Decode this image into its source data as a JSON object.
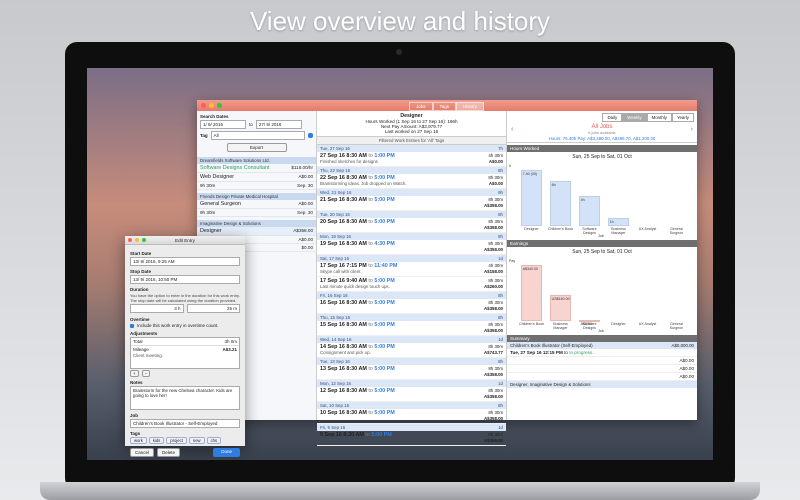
{
  "headline": "View overview and history",
  "window": {
    "tabs": [
      "Jobs",
      "Tags",
      "History"
    ],
    "active_tab": "History"
  },
  "left": {
    "search_dates_label": "Search Dates",
    "from_date": "1/ 9/ 2016",
    "to_label": "to",
    "to_date": "27/ 9/ 2016",
    "tag_label": "Tag",
    "tag_value": "All",
    "export_label": "Export",
    "groups": [
      {
        "head_left": "Dreamfields Software Solutions Ltd.",
        "head_right": "",
        "items": [
          {
            "title": "Software Designs Consultant",
            "right": "$116.00/hr",
            "sub_left": "",
            "sub_right": "Sep. 30",
            "title_class": "green"
          },
          {
            "title": "Web Designer",
            "right": "A$0.00",
            "sub_left": "9h 30m",
            "sub_right": "Sep. 30",
            "title_class": ""
          }
        ]
      },
      {
        "head_left": "Friends Design Private Medical Hospital",
        "head_right": "",
        "items": [
          {
            "title": "General Surgeon",
            "right": "A$0.00",
            "sub_left": "9h 30m",
            "sub_right": "Sep. 30",
            "title_class": ""
          }
        ]
      },
      {
        "head_left": "Imaginative Design & Solutions",
        "head_right": "",
        "items": [
          {
            "title": "Designer",
            "right": "A$358.00",
            "sub_left": "",
            "sub_right": "",
            "title_class": ""
          },
          {
            "title": "",
            "right": "A$0.00",
            "sub_left": "",
            "sub_right": "Oct. 30",
            "title_class": ""
          },
          {
            "title": "",
            "right": "$0.00",
            "sub_left": "",
            "sub_right": "Oct. 30",
            "title_class": ""
          }
        ]
      }
    ]
  },
  "mid": {
    "title": "Designer",
    "hours_line": "Hours Worked (1 Sep 16 to 27 Sep 16): 166h",
    "pay_line": "Next Pay Amount: A$3,979.77",
    "last_line": "Last worked on 27 Sep 16",
    "filter": "Filtered Work Entries for 'All' Tags",
    "days": [
      {
        "date": "Tue, 27 Sep 16",
        "total": "7h",
        "entries": [
          {
            "time": "27 Sep 16 8:30 AM",
            "to": "to",
            "end": "1:00 PM",
            "dur": "4h 30m",
            "note": "Finished sketches for designs",
            "amt": "A$0.00"
          }
        ]
      },
      {
        "date": "Thu, 22 Sep 16",
        "total": "8h",
        "entries": [
          {
            "time": "22 Sep 16 8:30 AM",
            "to": "to",
            "end": "5:00 PM",
            "dur": "8h 30m",
            "note": "Brainstorming ideas. Job dropped on Watch.",
            "amt": "A$0.00"
          }
        ]
      },
      {
        "date": "Wed, 21 Sep 16",
        "total": "9h",
        "entries": [
          {
            "time": "21 Sep 16 8:30 AM",
            "to": "to",
            "end": "5:00 PM",
            "dur": "8h 30m",
            "note": "",
            "amt": "A$358.00"
          }
        ]
      },
      {
        "date": "Tue, 20 Sep 16",
        "total": "8h",
        "entries": [
          {
            "time": "20 Sep 16 8:30 AM",
            "to": "to",
            "end": "5:00 PM",
            "dur": "8h 30m",
            "note": "",
            "amt": "A$358.00"
          }
        ]
      },
      {
        "date": "Mon, 19 Sep 16",
        "total": "8h",
        "entries": [
          {
            "time": "19 Sep 16 8:30 AM",
            "to": "to",
            "end": "4:30 PM",
            "dur": "8h 30m",
            "note": "",
            "amt": "A$358.00"
          }
        ]
      },
      {
        "date": "Sat, 17 Sep 16",
        "total": "1d",
        "entries": [
          {
            "time": "17 Sep 16 7:15 PM",
            "to": "to",
            "end": "11:40 PM",
            "dur": "4h 30m",
            "note": "Skype call with client",
            "amt": "A$158.00"
          },
          {
            "time": "17 Sep 16 9:40 AM",
            "to": "to",
            "end": "5:00 PM",
            "dur": "8h 30m",
            "note": "Last minute quick design touch ups.",
            "amt": "A$260.00"
          }
        ]
      },
      {
        "date": "Fri, 16 Sep 16",
        "total": "8h",
        "entries": [
          {
            "time": "16 Sep 16 8:30 AM",
            "to": "to",
            "end": "5:00 PM",
            "dur": "8h 30m",
            "note": "",
            "amt": "A$358.00"
          }
        ]
      },
      {
        "date": "Thu, 15 Sep 16",
        "total": "8h",
        "entries": [
          {
            "time": "15 Sep 16 8:30 AM",
            "to": "to",
            "end": "5:00 PM",
            "dur": "8h 30m",
            "note": "",
            "amt": "A$358.00"
          }
        ]
      },
      {
        "date": "Wed, 14 Sep 16",
        "total": "1d",
        "entries": [
          {
            "time": "14 Sep 16 8:30 AM",
            "to": "to",
            "end": "5:00 PM",
            "dur": "8h 30m",
            "note": "Consignment and pick up.",
            "amt": "A$743.77"
          }
        ]
      },
      {
        "date": "Tue, 13 Sep 16",
        "total": "8h",
        "entries": [
          {
            "time": "13 Sep 16 8:30 AM",
            "to": "to",
            "end": "5:00 PM",
            "dur": "8h 30m",
            "note": "",
            "amt": "A$358.00"
          }
        ]
      },
      {
        "date": "Mon, 12 Sep 16",
        "total": "1d",
        "entries": [
          {
            "time": "12 Sep 16 8:30 AM",
            "to": "to",
            "end": "5:00 PM",
            "dur": "8h 30m",
            "note": "",
            "amt": "A$358.00"
          }
        ]
      },
      {
        "date": "Sat, 10 Sep 16",
        "total": "8h",
        "entries": [
          {
            "time": "10 Sep 16 8:30 AM",
            "to": "to",
            "end": "5:00 PM",
            "dur": "8h 30m",
            "note": "",
            "amt": "A$358.00"
          }
        ]
      },
      {
        "date": "Fri, 9 Sep 16",
        "total": "1d",
        "entries": [
          {
            "time": "9 Sep 16 8:30 AM",
            "to": "to",
            "end": "5:00 PM",
            "dur": "8h 30m",
            "note": "",
            "amt": "A$358.00"
          }
        ]
      }
    ]
  },
  "right": {
    "tabs": [
      "Daily",
      "Weekly",
      "Monthly",
      "Yearly"
    ],
    "active_tab": "Weekly",
    "job_select": "All Jobs",
    "job_sub": "6 jobs available",
    "totals": "Hours: 76.40h  Pay: A$3,480.00, A$496.70, A$1,200.00",
    "hours_section": "Hours Worked",
    "earnings_section": "Earnings",
    "summary_section": "Summary",
    "range": "Sun, 25 Sep to Sat, 01 Oct",
    "xlabel": "Job",
    "hours_chart": {
      "unit": "h",
      "categories": [
        "Designer",
        "Children's Book",
        "Software Designs",
        "Business Manager",
        "UX Analyst",
        "General Surgeon"
      ],
      "values": [
        7.4,
        6.0,
        4.0,
        1.0,
        0,
        0
      ],
      "labels": [
        "7.40 (00)",
        "6h",
        "4h",
        "1h",
        "",
        ""
      ]
    },
    "earnings_chart": {
      "unit": "Pay",
      "categories": [
        "Children's Book",
        "Business Manager",
        "Software Designs",
        "Designer",
        "UX Analyst",
        "General Surgeon"
      ],
      "values": [
        340,
        160,
        5,
        0,
        0,
        0
      ],
      "labels": [
        "A$340.00",
        "US$160.00",
        "A$5.00",
        "",
        "",
        ""
      ]
    },
    "summary": {
      "head_left": "Children's Book Illustrator (Self-Employed)",
      "head_right": "A$0,000.00",
      "entry_time": "Tue, 27 Sep 16  12:15 PM",
      "entry_to": "to",
      "entry_status": "In progress...",
      "rows": [
        "A$0.00",
        "A$0.00",
        "A$0.00"
      ],
      "foot": "Designer, Imaginative Design & Solutions"
    }
  },
  "edit": {
    "title": "Edit Entry",
    "start_label": "Start Date",
    "start_value": "13/ 9/ 2016, 9:25 AM",
    "stop_label": "Stop Date",
    "stop_value": "13/ 9/ 2016, 10:50 PM",
    "duration_label": "Duration",
    "duration_help": "You have the option to enter in the duration for this work entry. The stop date will be calculated using the duration provided.",
    "dur_h": "3 h",
    "dur_m": "25 m",
    "overtime_label": "Overtime",
    "overtime_check": "Include this work entry in overtime count.",
    "adjust_label": "Adjustments",
    "adjust_total_label": "Total",
    "adjust_total_value": "3h 0m",
    "adjust_item": "Mileage",
    "adjust_item_amt": "A$3.21",
    "adjust_item_note": "Client meeting.",
    "notes_label": "Notes",
    "notes_text": "Brainstorm for the new Chelsea character. Kids are going to love her!",
    "job_label": "Job",
    "job_value": "Children's Book Illustrator - Self-Employed",
    "tags_label": "Tags",
    "tags": [
      "work",
      "kids",
      "project",
      "new",
      "chs"
    ],
    "cancel": "Cancel",
    "delete": "Delete",
    "done": "Done"
  }
}
